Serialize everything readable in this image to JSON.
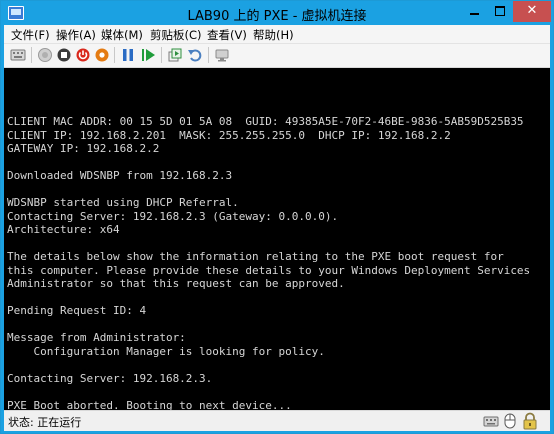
{
  "window": {
    "title": "LAB90 上的 PXE - 虚拟机连接",
    "min_icon": "minimize-icon",
    "max_icon": "maximize-icon",
    "close_label": "✕"
  },
  "menu": [
    {
      "label": "文件(F)"
    },
    {
      "label": "操作(A)"
    },
    {
      "label": "媒体(M)"
    },
    {
      "label": "剪贴板(C)"
    },
    {
      "label": "查看(V)"
    },
    {
      "label": "帮助(H)"
    }
  ],
  "toolbar": {
    "buttons": [
      "ctrl-alt-del-icon",
      "start-icon",
      "turn-off-icon",
      "shutdown-icon",
      "save-state-icon",
      "pause-icon",
      "resume-icon",
      "checkpoint-icon",
      "revert-icon",
      "enhanced-session-icon"
    ]
  },
  "console": {
    "lines": [
      "CLIENT MAC ADDR: 00 15 5D 01 5A 08  GUID: 49385A5E-70F2-46BE-9836-5AB59D525B35",
      "CLIENT IP: 192.168.2.201  MASK: 255.255.255.0  DHCP IP: 192.168.2.2",
      "GATEWAY IP: 192.168.2.2",
      "",
      "Downloaded WDSNBP from 192.168.2.3",
      "",
      "WDSNBP started using DHCP Referral.",
      "Contacting Server: 192.168.2.3 (Gateway: 0.0.0.0).",
      "Architecture: x64",
      "",
      "The details below show the information relating to the PXE boot request for",
      "this computer. Please provide these details to your Windows Deployment Services",
      "Administrator so that this request can be approved.",
      "",
      "Pending Request ID: 4",
      "",
      "Message from Administrator:",
      "    Configuration Manager is looking for policy.",
      "",
      "Contacting Server: 192.168.2.3.",
      "",
      "PXE Boot aborted. Booting to next device..."
    ]
  },
  "statusbar": {
    "status": "状态: 正在运行",
    "icons": [
      "keyboard-icon",
      "mouse-icon",
      "lock-icon"
    ]
  },
  "colors": {
    "titlebar": "#1ba1e2",
    "console_bg": "#000000",
    "console_text": "#d6d6d6",
    "close_button": "#c75050"
  }
}
